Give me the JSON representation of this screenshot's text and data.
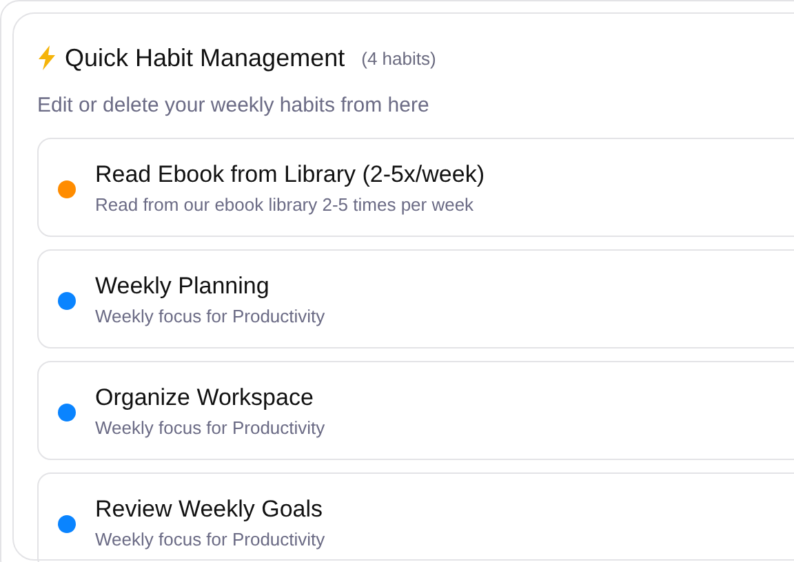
{
  "panel": {
    "title": "Quick Habit Management",
    "count": "(4 habits)",
    "subtitle": "Edit or delete your weekly habits from here"
  },
  "habits": [
    {
      "name": "Read Ebook from Library (2-5x/week)",
      "description": "Read from our ebook library 2-5 times per week",
      "color": "#ff8c00"
    },
    {
      "name": "Weekly Planning",
      "description": "Weekly focus for Productivity",
      "color": "#0a84ff"
    },
    {
      "name": "Organize Workspace",
      "description": "Weekly focus for Productivity",
      "color": "#0a84ff"
    },
    {
      "name": "Review Weekly Goals",
      "description": "Weekly focus for Productivity",
      "color": "#0a84ff"
    }
  ]
}
